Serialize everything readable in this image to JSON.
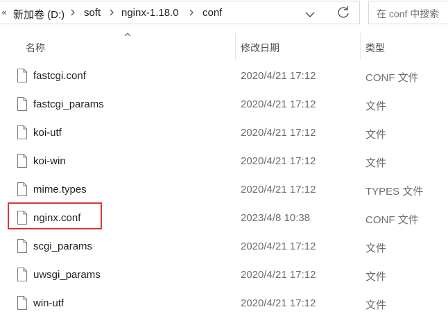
{
  "breadcrumb": {
    "overflow": "«",
    "items": [
      "新加卷 (D:)",
      "soft",
      "nginx-1.18.0",
      "conf"
    ]
  },
  "search": {
    "placeholder": "在 conf 中搜索"
  },
  "columns": {
    "name": "名称",
    "modified": "修改日期",
    "type": "类型"
  },
  "files": [
    {
      "name": "fastcgi.conf",
      "modified": "2020/4/21 17:12",
      "type": "CONF 文件"
    },
    {
      "name": "fastcgi_params",
      "modified": "2020/4/21 17:12",
      "type": "文件"
    },
    {
      "name": "koi-utf",
      "modified": "2020/4/21 17:12",
      "type": "文件"
    },
    {
      "name": "koi-win",
      "modified": "2020/4/21 17:12",
      "type": "文件"
    },
    {
      "name": "mime.types",
      "modified": "2020/4/21 17:12",
      "type": "TYPES 文件"
    },
    {
      "name": "nginx.conf",
      "modified": "2023/4/8 10:38",
      "type": "CONF 文件",
      "highlighted": true
    },
    {
      "name": "scgi_params",
      "modified": "2020/4/21 17:12",
      "type": "文件"
    },
    {
      "name": "uwsgi_params",
      "modified": "2020/4/21 17:12",
      "type": "文件"
    },
    {
      "name": "win-utf",
      "modified": "2020/4/21 17:12",
      "type": "文件"
    }
  ],
  "colors": {
    "highlight": "#d9363e",
    "text": "#1f1f1f",
    "muted": "#6d6d6d"
  },
  "icons": {
    "sep": "chevron-right-icon",
    "dropdown": "chevron-down-icon",
    "refresh": "refresh-icon",
    "file": "file-icon",
    "sort": "sort-ascending-icon"
  }
}
